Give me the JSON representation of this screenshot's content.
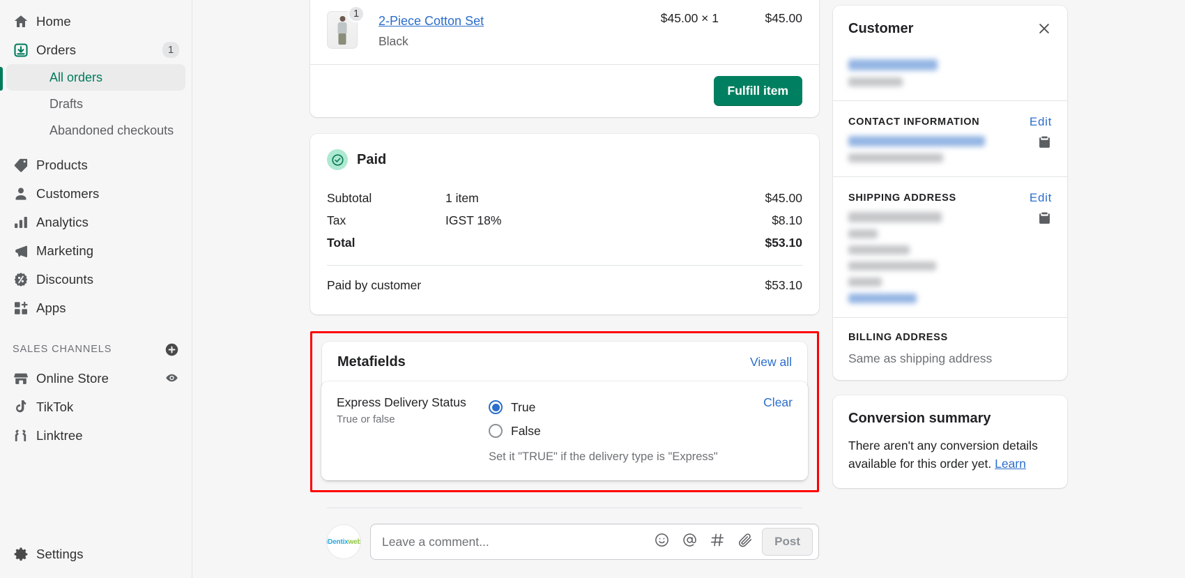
{
  "sidebar": {
    "items": [
      {
        "label": "Home",
        "icon": "home-icon",
        "badge": ""
      },
      {
        "label": "Orders",
        "icon": "orders-icon",
        "badge": "1"
      },
      {
        "label": "Products",
        "icon": "products-tag-icon",
        "badge": ""
      },
      {
        "label": "Customers",
        "icon": "customers-person-icon",
        "badge": ""
      },
      {
        "label": "Analytics",
        "icon": "analytics-bars-icon",
        "badge": ""
      },
      {
        "label": "Marketing",
        "icon": "marketing-megaphone-icon",
        "badge": ""
      },
      {
        "label": "Discounts",
        "icon": "discounts-percent-icon",
        "badge": ""
      },
      {
        "label": "Apps",
        "icon": "apps-grid-plus-icon",
        "badge": ""
      }
    ],
    "orders_sub": [
      {
        "label": "All orders",
        "active": true
      },
      {
        "label": "Drafts",
        "active": false
      },
      {
        "label": "Abandoned checkouts",
        "active": false
      }
    ],
    "sales_channels_label": "SALES CHANNELS",
    "add_channel_icon": "plus-circle-icon",
    "channels": [
      {
        "label": "Online Store",
        "icon": "storefront-icon",
        "trailing_icon": "eye-icon"
      },
      {
        "label": "TikTok",
        "icon": "tiktok-icon",
        "trailing_icon": ""
      },
      {
        "label": "Linktree",
        "icon": "linktree-icon",
        "trailing_icon": ""
      }
    ],
    "settings_label": "Settings",
    "settings_icon": "gear-icon"
  },
  "line_item": {
    "quantity_badge": "1",
    "product_name": "2-Piece Cotton Set",
    "variant": "Black",
    "unit_price": "$45.00 × 1",
    "line_total": "$45.00",
    "fulfill_label": "Fulfill item"
  },
  "payment": {
    "status": "Paid",
    "status_icon": "check-circle-icon",
    "rows": [
      {
        "label": "Subtotal",
        "detail": "1 item",
        "value": "$45.00",
        "bold": false
      },
      {
        "label": "Tax",
        "detail": "IGST 18%",
        "value": "$8.10",
        "bold": false
      },
      {
        "label": "Total",
        "detail": "",
        "value": "$53.10",
        "bold": true
      }
    ],
    "paid_by_label": "Paid by customer",
    "paid_by_value": "$53.10"
  },
  "metafields": {
    "title": "Metafields",
    "view_all_label": "View all",
    "field_name": "Express Delivery Status",
    "field_type": "True or false",
    "options": [
      {
        "label": "True",
        "selected": true
      },
      {
        "label": "False",
        "selected": false
      }
    ],
    "hint": "Set it \"TRUE\" if the delivery type is \"Express\"",
    "clear_label": "Clear",
    "highlight_color": "#ff0000"
  },
  "comment": {
    "placeholder": "Leave a comment...",
    "post_label": "Post",
    "avatar_text_1": "iDentix",
    "avatar_text_2": "web",
    "icons": [
      "emoji-icon",
      "mention-at-icon",
      "hashtag-icon",
      "attachment-paperclip-icon"
    ]
  },
  "customer_panel": {
    "title": "Customer",
    "close_icon": "close-icon",
    "contact_information_label": "CONTACT INFORMATION",
    "contact_edit_label": "Edit",
    "shipping_address_label": "SHIPPING ADDRESS",
    "shipping_edit_label": "Edit",
    "billing_address_label": "BILLING ADDRESS",
    "billing_address_value": "Same as shipping address",
    "copy_icon": "clipboard-copy-icon"
  },
  "conversion": {
    "title": "Conversion summary",
    "text": "There aren't any conversion details available for this order yet. ",
    "link_label": "Learn"
  },
  "colors": {
    "brand_green": "#008060",
    "link_blue": "#2c6ecb",
    "highlight_red": "#ff0000",
    "paid_badge_bg": "#aee9d1"
  }
}
